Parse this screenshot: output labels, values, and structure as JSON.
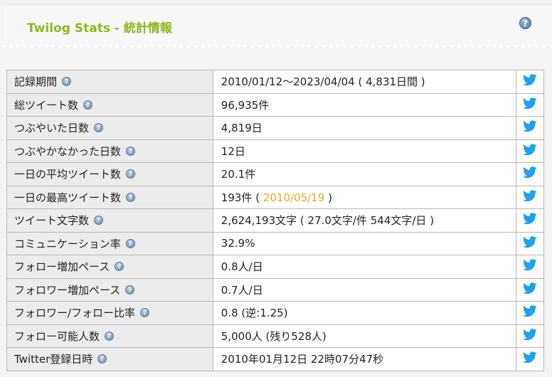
{
  "header": {
    "title": "Twilog Stats - 統計情報"
  },
  "colors": {
    "title_green": "#8cb81f",
    "twitter_blue": "#1da1f2",
    "link_orange": "#e8a61f"
  },
  "rows": [
    {
      "label": "記録期間",
      "value": "2010/01/12～2023/04/04 ( 4,831日間 )"
    },
    {
      "label": "総ツイート数",
      "value": "96,935件"
    },
    {
      "label": "つぶやいた日数",
      "value": "4,819日"
    },
    {
      "label": "つぶやかなかった日数",
      "value": "12日"
    },
    {
      "label": "一日の平均ツイート数",
      "value": "20.1件"
    },
    {
      "label": "一日の最高ツイート数",
      "value_prefix": "193件 ( ",
      "value_link": "2010/05/19",
      "value_suffix": " )"
    },
    {
      "label": "ツイート文字数",
      "value": "2,624,193文字 ( 27.0文字/件 544文字/日 )"
    },
    {
      "label": "コミュニケーション率",
      "value": "32.9%"
    },
    {
      "label": "フォロー増加ペース",
      "value": "0.8人/日"
    },
    {
      "label": "フォロワー増加ペース",
      "value": "0.7人/日"
    },
    {
      "label": "フォロワー/フォロー比率",
      "value": "0.8 (逆:1.25)"
    },
    {
      "label": "フォロー可能人数",
      "value": "5,000人 (残り528人)"
    },
    {
      "label": "Twitter登録日時",
      "value": "2010年01月12日 22時07分47秒"
    }
  ],
  "icons": {
    "help": "help-icon",
    "share": "twitter-bird-icon"
  }
}
